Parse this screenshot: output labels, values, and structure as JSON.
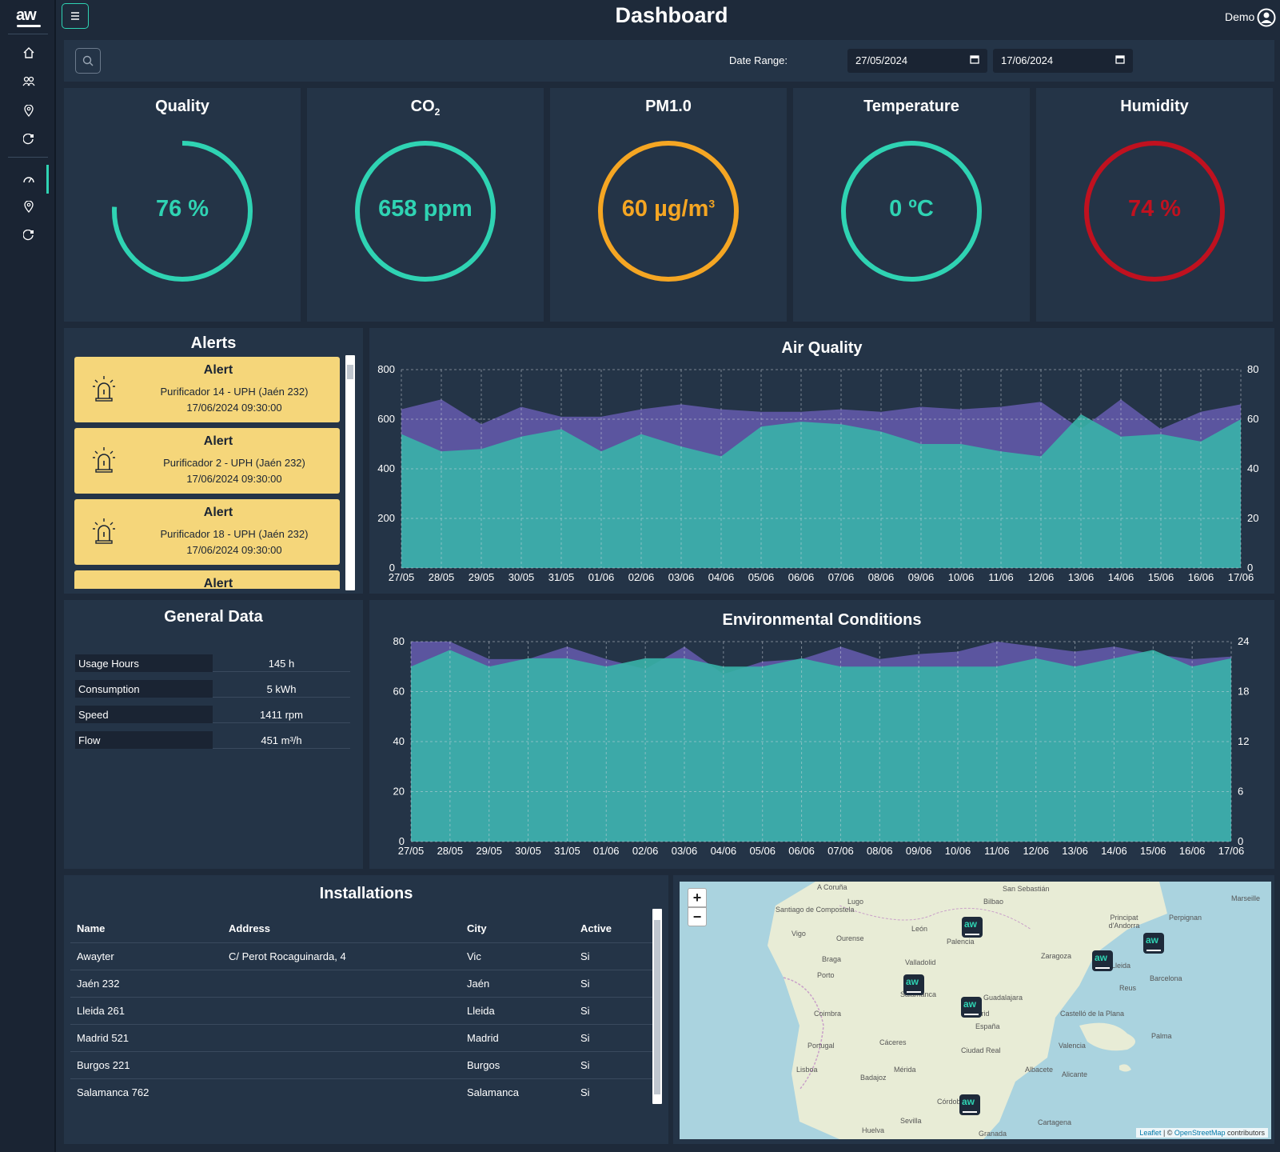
{
  "app": {
    "logo_text": "aw",
    "title": "Dashboard",
    "user": "Demo"
  },
  "sidebar": {
    "items": [
      {
        "icon": "home-icon"
      },
      {
        "icon": "users-icon"
      },
      {
        "icon": "location-pin-icon"
      },
      {
        "icon": "device-icon"
      },
      {
        "icon": "gauge-icon",
        "active": true
      },
      {
        "icon": "location-pin-icon"
      },
      {
        "icon": "device-icon"
      }
    ]
  },
  "filter": {
    "date_label": "Date Range:",
    "start_date": "27/05/2024",
    "end_date": "17/06/2024"
  },
  "kpis": [
    {
      "title": "Quality",
      "value": "76 %",
      "color": "#2fd3b3",
      "fill": 0.76
    },
    {
      "title": "CO",
      "sub": "2",
      "value": "658 ppm",
      "color": "#2fd3b3",
      "fill": 1.0
    },
    {
      "title": "PM1.0",
      "value": "60 µg/m",
      "sup": "3",
      "color": "#f5a623",
      "fill": 1.0
    },
    {
      "title": "Temperature",
      "value": "0 ºC",
      "color": "#2fd3b3",
      "fill": 1.0
    },
    {
      "title": "Humidity",
      "value": "74 %",
      "color": "#c0111f",
      "fill": 1.0
    }
  ],
  "alerts": {
    "title": "Alerts",
    "items": [
      {
        "title": "Alert",
        "device": "Purificador 14 - UPH (Jaén 232)",
        "time": "17/06/2024 09:30:00"
      },
      {
        "title": "Alert",
        "device": "Purificador 2 - UPH (Jaén 232)",
        "time": "17/06/2024 09:30:00"
      },
      {
        "title": "Alert",
        "device": "Purificador 18 - UPH (Jaén 232)",
        "time": "17/06/2024 09:30:00"
      },
      {
        "title": "Alert",
        "device": "",
        "time": ""
      }
    ]
  },
  "general": {
    "title": "General Data",
    "rows": [
      {
        "label": "Usage Hours",
        "value": "145 h"
      },
      {
        "label": "Consumption",
        "value": "5 kWh"
      },
      {
        "label": "Speed",
        "value": "1411 rpm"
      },
      {
        "label": "Flow",
        "value": "451 m³/h"
      }
    ]
  },
  "installations": {
    "title": "Installations",
    "headers": [
      "Name",
      "Address",
      "City",
      "Active"
    ],
    "rows": [
      [
        "Awayter",
        "C/ Perot Rocaguinarda, 4",
        "Vic",
        "Si"
      ],
      [
        "Jaén 232",
        "",
        "Jaén",
        "Si"
      ],
      [
        "Lleida 261",
        "",
        "Lleida",
        "Si"
      ],
      [
        "Madrid 521",
        "",
        "Madrid",
        "Si"
      ],
      [
        "Burgos 221",
        "",
        "Burgos",
        "Si"
      ],
      [
        "Salamanca 762",
        "",
        "Salamanca",
        "Si"
      ]
    ]
  },
  "map": {
    "zoom_in": "+",
    "zoom_out": "−",
    "attribution_leaflet": "Leaflet",
    "attribution_sep": " | © ",
    "attribution_osm": "OpenStreetMap",
    "attribution_tail": " contributors",
    "labels": [
      "A Coruña",
      "Lugo",
      "Santiago de Compostela",
      "Vigo",
      "Ourense",
      "León",
      "Palencia",
      "Valladolid",
      "Bilbao",
      "San Sebastián",
      "Zaragoza",
      "Barcelona",
      "Lleida",
      "Reus",
      "Salamanca",
      "Madrid",
      "Guadalajara",
      "España",
      "Coimbra",
      "Portugal",
      "Cáceres",
      "Mérida",
      "Badajoz",
      "Lisboa",
      "Ciudad Real",
      "Albacete",
      "Alicante",
      "Valencia",
      "Castelló de la Plana",
      "Palma",
      "Córdoba",
      "Sevilla",
      "Huelva",
      "Granada",
      "Cartagena",
      "Marseille",
      "Perpignan",
      "Principat d'Andorra",
      "Braga",
      "Porto"
    ]
  },
  "chart_data": [
    {
      "type": "area",
      "title": "Air Quality",
      "x": [
        "27/05",
        "28/05",
        "29/05",
        "30/05",
        "31/05",
        "01/06",
        "02/06",
        "03/06",
        "04/06",
        "05/06",
        "06/06",
        "07/06",
        "08/06",
        "09/06",
        "10/06",
        "11/06",
        "12/06",
        "13/06",
        "14/06",
        "15/06",
        "16/06",
        "17/06"
      ],
      "ylim": [
        0,
        800
      ],
      "y2lim": [
        0,
        80
      ],
      "yticks": [
        0,
        200,
        400,
        600,
        800
      ],
      "y2ticks": [
        0,
        20,
        40,
        60,
        80
      ],
      "series": [
        {
          "axis": "left",
          "color": "#6259a8",
          "values": [
            640,
            680,
            580,
            650,
            610,
            610,
            640,
            660,
            640,
            630,
            630,
            640,
            630,
            650,
            640,
            650,
            670,
            560,
            680,
            560,
            630,
            660
          ]
        },
        {
          "axis": "right",
          "color": "#39b2a9",
          "values": [
            54,
            47,
            48,
            53,
            56,
            47,
            54,
            49,
            45,
            57,
            59,
            58,
            55,
            50,
            50,
            47,
            45,
            62,
            53,
            54,
            51,
            60
          ]
        }
      ],
      "grid": true
    },
    {
      "type": "area",
      "title": "Environmental Conditions",
      "x": [
        "27/05",
        "28/05",
        "29/05",
        "30/05",
        "31/05",
        "01/06",
        "02/06",
        "03/06",
        "04/06",
        "05/06",
        "06/06",
        "07/06",
        "08/06",
        "09/06",
        "10/06",
        "11/06",
        "12/06",
        "13/06",
        "14/06",
        "15/06",
        "16/06",
        "17/06"
      ],
      "ylim": [
        0,
        80
      ],
      "y2lim": [
        0,
        24
      ],
      "yticks": [
        0,
        20,
        40,
        60,
        80
      ],
      "y2ticks": [
        0,
        6,
        12,
        18,
        24
      ],
      "series": [
        {
          "axis": "left",
          "color": "#6259a8",
          "values": [
            80,
            80,
            73,
            73,
            78,
            73,
            69,
            78,
            67,
            72,
            73,
            78,
            73,
            75,
            76,
            80,
            78,
            76,
            78,
            75,
            73,
            74
          ]
        },
        {
          "axis": "right",
          "color": "#39b2a9",
          "values": [
            21,
            23,
            21,
            22,
            22,
            21,
            22,
            22,
            21,
            21,
            22,
            21,
            21,
            21,
            21,
            21,
            22,
            21,
            22,
            23,
            21,
            22
          ]
        }
      ],
      "grid": true
    }
  ]
}
